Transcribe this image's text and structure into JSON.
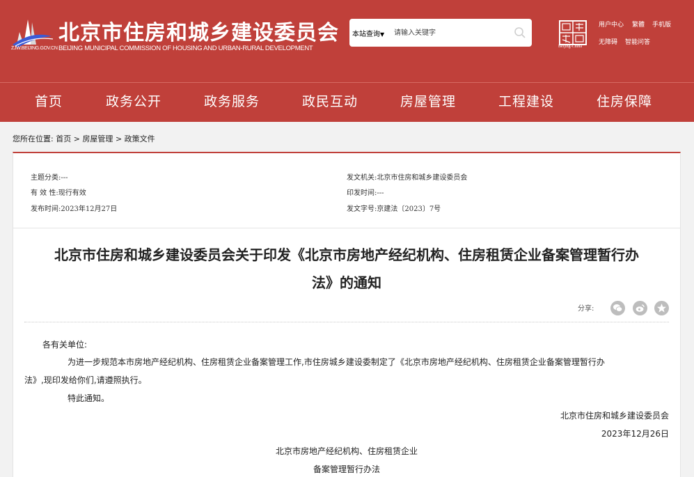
{
  "header": {
    "logo_url_text": "ZJW.BEIJING.GOV.CN",
    "site_title": "北京市住房和城乡建设委员会",
    "site_subtitle": "BEIJING MUNICIPAL COMMISSION OF HOUSING AND URBAN-RURAL DEVELOPMENT",
    "search": {
      "scope": "本站查询",
      "placeholder": "请输入关键字"
    },
    "seal_caption": "Beijing-China",
    "links": {
      "user_center": "用户中心",
      "traditional": "繁體",
      "mobile": "手机版",
      "accessibility": "无障碍",
      "smart_qa": "智能问答"
    }
  },
  "nav": {
    "items": [
      "首页",
      "政务公开",
      "政务服务",
      "政民互动",
      "房屋管理",
      "工程建设",
      "住房保障"
    ]
  },
  "breadcrumb": {
    "prefix": "您所在位置:",
    "items": [
      "首页",
      "房屋管理",
      "政策文件"
    ],
    "separator": ">"
  },
  "meta": {
    "topic": "主题分类:---",
    "validity": "有 效 性:现行有效",
    "publish_date": "发布时间:2023年12月27日",
    "issuer": "发文机关:北京市住房和城乡建设委员会",
    "print_date": "印发时间:---",
    "doc_number": "发文字号:京建法〔2023〕7号"
  },
  "article": {
    "title_line1": "北京市住房和城乡建设委员会关于印发《北京市房地产经纪机构、住房租赁企业备案管理暂行办",
    "title_line2": "法》的通知",
    "share_label": "分享:",
    "salutation": "各有关单位:",
    "para1_line1": "为进一步规范本市房地产经纪机构、住房租赁企业备案管理工作,市住房城乡建设委制定了《北京市房地产经纪机构、住房租赁企业备案管理暂行办",
    "para1_line2": "法》,现印发给你们,请遵照执行。",
    "para2": "特此通知。",
    "signature": "北京市住房和城乡建设委员会",
    "date": "2023年12月26日",
    "attachment_line1": "北京市房地产经纪机构、住房租赁企业",
    "attachment_line2": "备案管理暂行办法"
  },
  "colors": {
    "brand_red": "#c0403a",
    "page_bg": "#f2f2f2"
  }
}
